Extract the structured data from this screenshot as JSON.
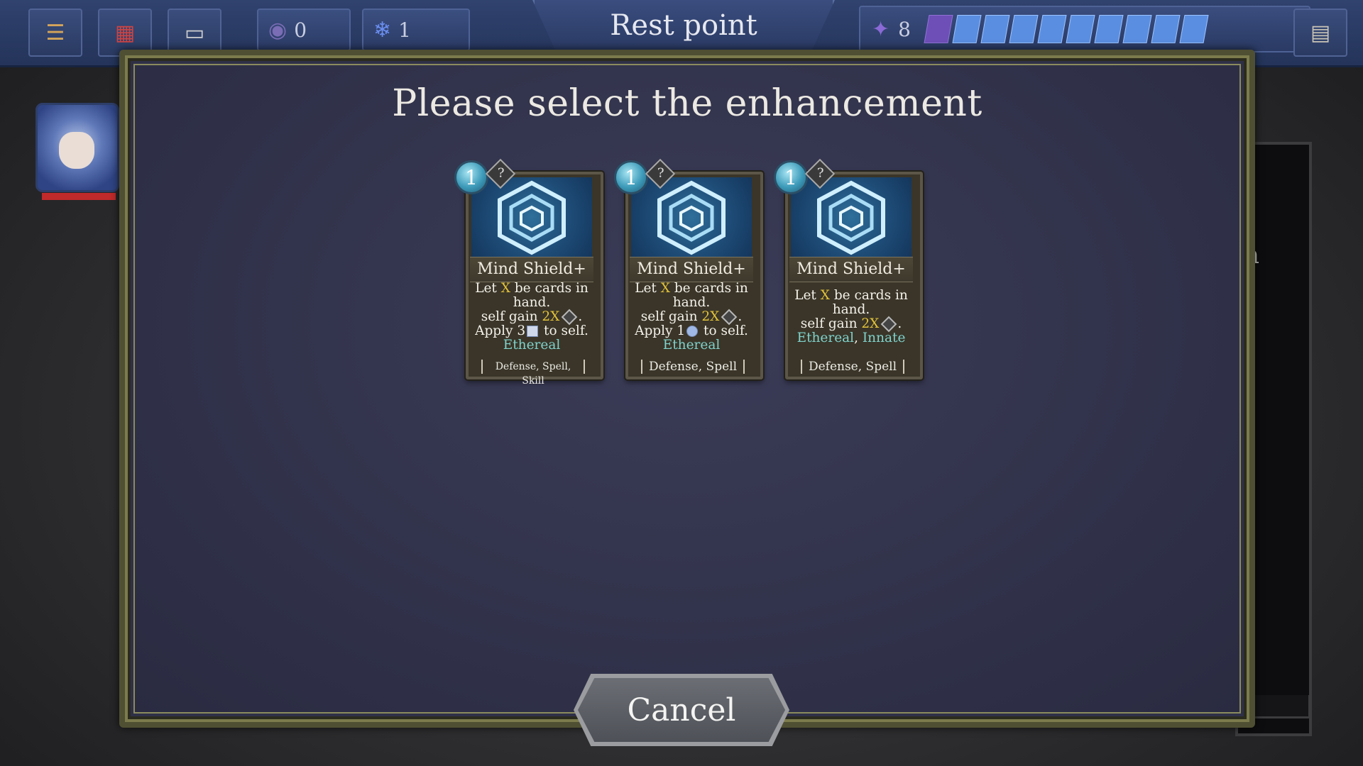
{
  "topbar": {
    "title": "Rest point",
    "stat_1_value": "0",
    "stat_2_value": "1",
    "hp_value": "8",
    "hp_segments_total": 10,
    "icons": {
      "deck": "stack-icon",
      "relic": "chest-icon",
      "map": "scroll-icon",
      "book": "book-icon",
      "orb": "orb-icon",
      "crystal": "crystal-icon"
    }
  },
  "modal": {
    "title": "Please select the enhancement",
    "cancel_label": "Cancel"
  },
  "cards": [
    {
      "cost": "1",
      "mana": "?",
      "name": "Mind Shield+",
      "desc_line1_pre": "Let ",
      "desc_x": "X",
      "desc_line1_post": " be cards in hand.",
      "desc_line2_pre": "self gain ",
      "desc_2x": "2X",
      "desc_line2_post": ".",
      "desc_line3_pre": "Apply 3",
      "desc_line3_post": " to self.",
      "keywords": "Ethereal",
      "keywords_b": "",
      "tags": "Defense, Spell, Skill"
    },
    {
      "cost": "1",
      "mana": "?",
      "name": "Mind Shield+",
      "desc_line1_pre": "Let ",
      "desc_x": "X",
      "desc_line1_post": " be cards in hand.",
      "desc_line2_pre": "self gain ",
      "desc_2x": "2X",
      "desc_line2_post": ".",
      "desc_line3_pre": "Apply 1",
      "desc_line3_post": " to self.",
      "keywords": "Ethereal",
      "keywords_b": "",
      "tags": "Defense, Spell"
    },
    {
      "cost": "1",
      "mana": "?",
      "name": "Mind Shield+",
      "desc_line1_pre": "Let ",
      "desc_x": "X",
      "desc_line1_post": " be cards in hand.",
      "desc_line2_pre": "self gain ",
      "desc_2x": "2X",
      "desc_line2_post": ".",
      "desc_line3_pre": "",
      "desc_line3_post": "",
      "keywords": "Ethereal",
      "keywords_sep": ", ",
      "keywords_b": "Innate",
      "tags": "Defense, Spell"
    }
  ],
  "background": {
    "partial_text": "n"
  },
  "colors": {
    "highlight": "#e2c23a",
    "keyword": "#7fd2cc",
    "hp_bar": "#c02a2a",
    "segment": "#5a8ee0"
  }
}
